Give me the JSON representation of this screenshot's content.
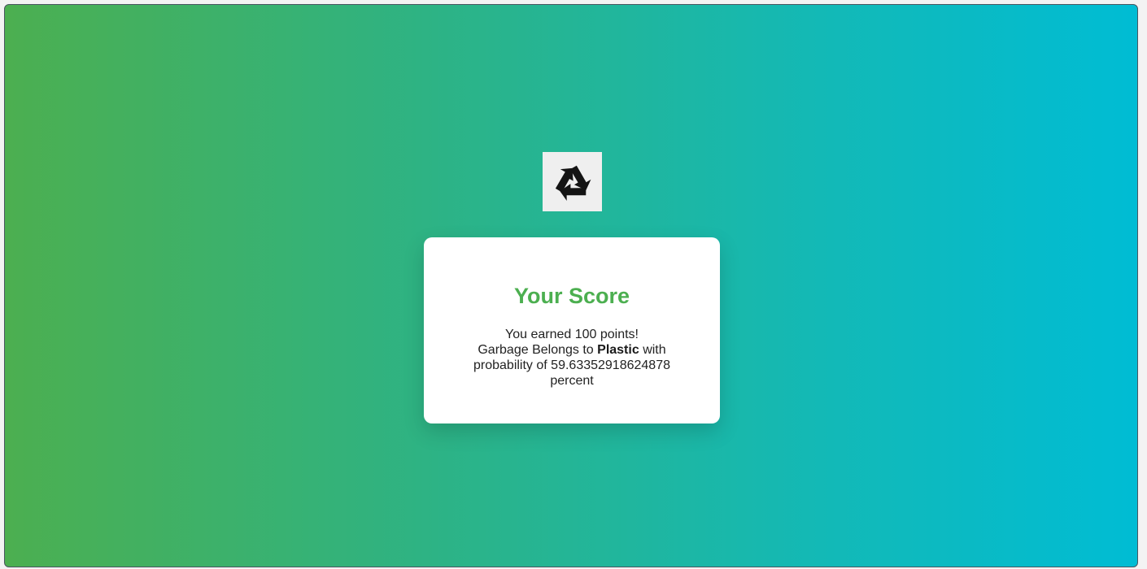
{
  "theme": {
    "gradient_start": "#4caf50",
    "gradient_end": "#00bcd4",
    "title_color": "#4caf50"
  },
  "logo": {
    "icon": "recycle-icon"
  },
  "result": {
    "title": "Your Score",
    "points_line": "You earned 100 points!",
    "belongs_prefix": "Garbage Belongs to",
    "category": "Plastic",
    "probability_prefix": "with probability of",
    "probability": "59.63352918624878",
    "unit": "percent"
  }
}
